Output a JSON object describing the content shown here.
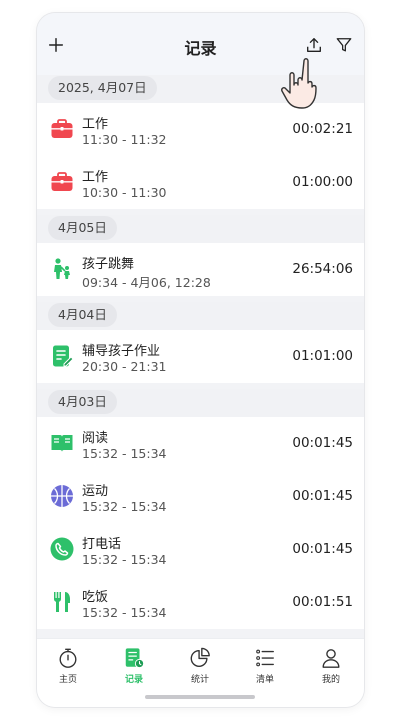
{
  "header": {
    "title": "记录",
    "add_icon": "plus-icon",
    "export_icon": "export-icon",
    "filter_icon": "filter-icon"
  },
  "groups": [
    {
      "date": "2025, 4月07日",
      "items": [
        {
          "name": "工作",
          "time": "11:30 - 11:32",
          "duration": "00:02:21",
          "icon": "briefcase-icon",
          "color": "#f0474f"
        },
        {
          "name": "工作",
          "time": "10:30 - 11:30",
          "duration": "01:00:00",
          "icon": "briefcase-icon",
          "color": "#f0474f"
        }
      ]
    },
    {
      "date": "4月05日",
      "items": [
        {
          "name": "孩子跳舞",
          "time": "09:34 - 4月06, 12:28",
          "duration": "26:54:06",
          "icon": "parent-child-icon",
          "color": "#2ec06a"
        }
      ]
    },
    {
      "date": "4月04日",
      "items": [
        {
          "name": "辅导孩子作业",
          "time": "20:30 - 21:31",
          "duration": "01:01:00",
          "icon": "homework-icon",
          "color": "#2ec06a"
        }
      ]
    },
    {
      "date": "4月03日",
      "items": [
        {
          "name": "阅读",
          "time": "15:32 - 15:34",
          "duration": "00:01:45",
          "icon": "book-icon",
          "color": "#2ec06a"
        },
        {
          "name": "运动",
          "time": "15:32 - 15:34",
          "duration": "00:01:45",
          "icon": "basketball-icon",
          "color": "#6b6bd6"
        },
        {
          "name": "打电话",
          "time": "15:32 - 15:34",
          "duration": "00:01:45",
          "icon": "phone-icon",
          "color": "#2ec06a"
        },
        {
          "name": "吃饭",
          "time": "15:32 - 15:34",
          "duration": "00:01:51",
          "icon": "utensils-icon",
          "color": "#2ec06a"
        }
      ]
    }
  ],
  "tabs": [
    {
      "label": "主页",
      "icon": "timer-icon",
      "active": false
    },
    {
      "label": "记录",
      "icon": "record-icon",
      "active": true
    },
    {
      "label": "统计",
      "icon": "pie-chart-icon",
      "active": false
    },
    {
      "label": "清单",
      "icon": "list-icon",
      "active": false
    },
    {
      "label": "我的",
      "icon": "person-icon",
      "active": false
    }
  ],
  "colors": {
    "accent": "#2ec06a",
    "work": "#f0474f",
    "sport": "#6b6bd6"
  }
}
